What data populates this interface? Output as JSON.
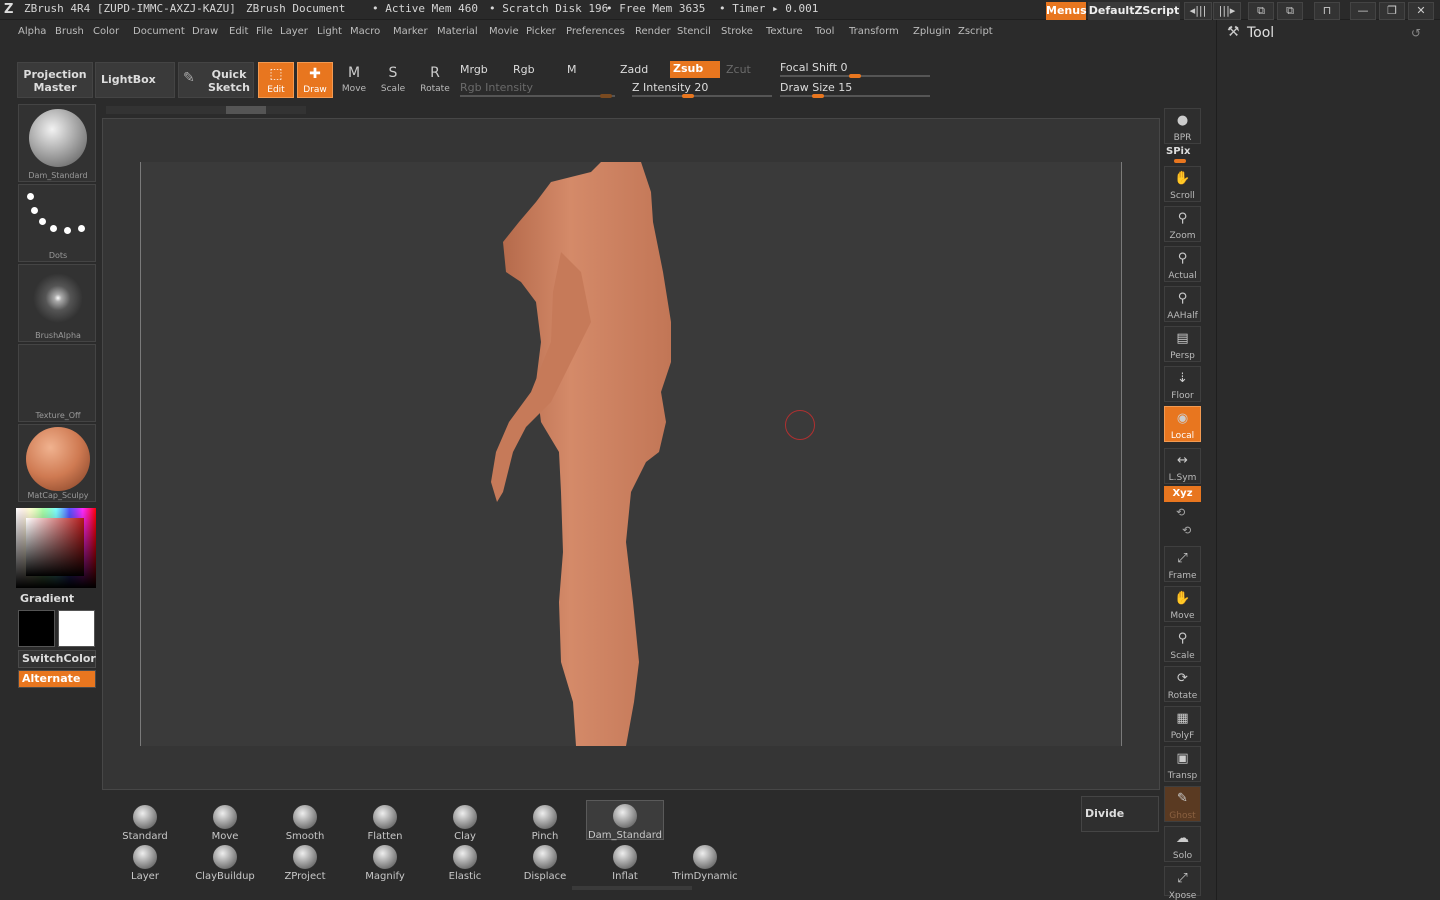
{
  "titlebar": {
    "app": "ZBrush 4R4 [ZUPD-IMMC-AXZJ-KAZU]",
    "document": "ZBrush Document",
    "mem_active": "• Active Mem 460",
    "scratch": "• Scratch Disk 196",
    "free_mem": "• Free Mem 3635",
    "timer": "• Timer ▸ 0.001",
    "menus_label": "Menus",
    "script_label": "DefaultZScript"
  },
  "menubar": [
    "Alpha",
    "Brush",
    "Color",
    "Document",
    "Draw",
    "Edit",
    "File",
    "Layer",
    "Light",
    "Macro",
    "Marker",
    "Material",
    "Movie",
    "Picker",
    "Preferences",
    "Render",
    "Stencil",
    "Stroke",
    "Texture",
    "Tool",
    "Transform",
    "Zplugin",
    "Zscript"
  ],
  "shelf": {
    "projection_master": "Projection Master",
    "lightbox": "LightBox",
    "quick_sketch": "Quick Sketch",
    "edit": "Edit",
    "draw": "Draw",
    "move": "Move",
    "scale": "Scale",
    "rotate": "Rotate",
    "mrgb": "Mrgb",
    "rgb": "Rgb",
    "m": "M",
    "zadd": "Zadd",
    "zsub": "Zsub",
    "zcut": "Zcut",
    "rgb_intensity": "Rgb Intensity",
    "z_intensity": "Z Intensity 20",
    "focal_shift": "Focal Shift 0",
    "draw_size": "Draw Size 15"
  },
  "left_tray": {
    "brush_label": "Dam_Standard",
    "stroke_label": "Dots",
    "alpha_label": "BrushAlpha",
    "texture_label": "Texture_Off",
    "material_label": "MatCap_Sculpy",
    "gradient": "Gradient",
    "switch_color": "SwitchColor",
    "alternate": "Alternate"
  },
  "right_tray": {
    "bpr": "BPR",
    "spix": "SPix",
    "items": [
      "Scroll",
      "Zoom",
      "Actual",
      "AAHalf",
      "Persp",
      "Floor",
      "Local",
      "L.Sym",
      "Xyz",
      "Frame",
      "Move",
      "Scale",
      "Rotate",
      "PolyF",
      "Transp",
      "Ghost",
      "Solo",
      "Xpose"
    ]
  },
  "tool_palette": {
    "title": "Tool"
  },
  "brushes": {
    "row1": [
      "Standard",
      "Move",
      "Smooth",
      "Flatten",
      "Clay",
      "Pinch",
      "Dam_Standard"
    ],
    "row2": [
      "Layer",
      "ClayBuildup",
      "ZProject",
      "Magnify",
      "Elastic",
      "Displace",
      "Inflat",
      "TrimDynamic"
    ],
    "divide": "Divide"
  },
  "colors": {
    "accent": "#e8761f",
    "skin": "#d2876a",
    "background": "#2b2b2b",
    "canvas": "#3a3a3a"
  }
}
